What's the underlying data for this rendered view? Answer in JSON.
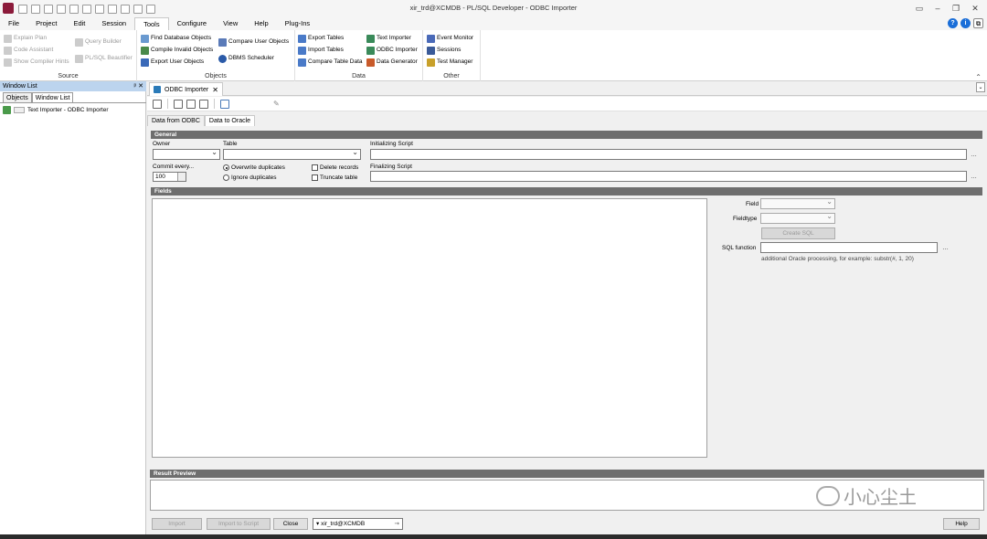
{
  "window": {
    "title": "xir_trd@XCMDB - PL/SQL Developer - ODBC Importer"
  },
  "menu": [
    "File",
    "Project",
    "Edit",
    "Session",
    "Tools",
    "Configure",
    "View",
    "Help",
    "Plug-Ins"
  ],
  "ribbon": {
    "source": {
      "label": "Source",
      "items": [
        "Explain Plan",
        "Code Assistant",
        "Show Compiler Hints",
        "Query Builder",
        "PL/SQL Beautifier"
      ]
    },
    "objects": {
      "label": "Objects",
      "items": [
        "Find Database Objects",
        "Compile Invalid Objects",
        "Export User Objects",
        "Compare User Objects",
        "DBMS Scheduler"
      ]
    },
    "data": {
      "label": "Data",
      "items": [
        "Export Tables",
        "Import Tables",
        "Compare Table Data",
        "Text Importer",
        "ODBC Importer",
        "Data Generator"
      ]
    },
    "other": {
      "label": "Other",
      "items": [
        "Event Monitor",
        "Sessions",
        "Test Manager"
      ]
    }
  },
  "left_panel": {
    "title": "Window List",
    "tabs": [
      "Objects",
      "Window List"
    ],
    "items": [
      "Text Importer - ODBC Importer"
    ]
  },
  "doc_tab": {
    "label": "ODBC Importer"
  },
  "sub_tabs": [
    "Data from ODBC",
    "Data to Oracle"
  ],
  "general": {
    "header": "General",
    "owner_label": "Owner",
    "table_label": "Table",
    "init_script_label": "Initializing Script",
    "final_script_label": "Finalizing Script",
    "commit_label": "Commit every...",
    "commit_value": "100",
    "overwrite": "Overwrite duplicates",
    "ignore": "Ignore duplicates",
    "delete": "Delete records",
    "truncate": "Truncate table"
  },
  "fields": {
    "header": "Fields",
    "field_label": "Field",
    "fieldtype_label": "Fieldtype",
    "create_sql": "Create SQL",
    "sql_function_label": "SQL function",
    "hint": "additional Oracle processing, for example: substr(#, 1, 20)"
  },
  "result_preview": {
    "header": "Result Preview"
  },
  "bottom": {
    "import": "Import",
    "import_script": "Import to Script",
    "close": "Close",
    "connection": "xir_trd@XCMDB",
    "help": "Help"
  },
  "watermark": "小心尘土"
}
